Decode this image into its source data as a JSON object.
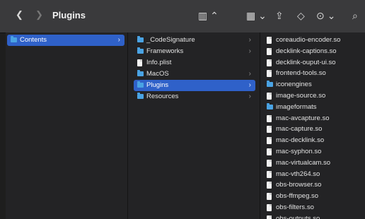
{
  "window": {
    "title": "Plugins"
  },
  "toolbar": {
    "back_glyph": "❮",
    "forward_glyph": "❯",
    "view_glyph": "▥ ⌃",
    "group_glyph": "▦ ⌄",
    "share_glyph": "⇪",
    "tag_glyph": "◇",
    "more_glyph": "⊙ ⌄",
    "search_glyph": "⌕"
  },
  "columns": {
    "col1": [
      {
        "name": "Contents",
        "type": "folder",
        "has_children": true,
        "selected": true
      }
    ],
    "col2": [
      {
        "name": "_CodeSignature",
        "type": "folder",
        "has_children": true,
        "selected": false
      },
      {
        "name": "Frameworks",
        "type": "folder",
        "has_children": true,
        "selected": false
      },
      {
        "name": "Info.plist",
        "type": "file",
        "has_children": false,
        "selected": false
      },
      {
        "name": "MacOS",
        "type": "folder",
        "has_children": true,
        "selected": false
      },
      {
        "name": "Plugins",
        "type": "folder",
        "has_children": true,
        "selected": true
      },
      {
        "name": "Resources",
        "type": "folder",
        "has_children": true,
        "selected": false
      }
    ],
    "col3": [
      {
        "name": "coreaudio-encoder.so",
        "type": "file"
      },
      {
        "name": "decklink-captions.so",
        "type": "file"
      },
      {
        "name": "decklink-ouput-ui.so",
        "type": "file"
      },
      {
        "name": "frontend-tools.so",
        "type": "file"
      },
      {
        "name": "iconengines",
        "type": "folder"
      },
      {
        "name": "image-source.so",
        "type": "file"
      },
      {
        "name": "imageformats",
        "type": "folder"
      },
      {
        "name": "mac-avcapture.so",
        "type": "file"
      },
      {
        "name": "mac-capture.so",
        "type": "file"
      },
      {
        "name": "mac-decklink.so",
        "type": "file"
      },
      {
        "name": "mac-syphon.so",
        "type": "file"
      },
      {
        "name": "mac-virtualcam.so",
        "type": "file"
      },
      {
        "name": "mac-vth264.so",
        "type": "file"
      },
      {
        "name": "obs-browser.so",
        "type": "file"
      },
      {
        "name": "obs-ffmpeg.so",
        "type": "file"
      },
      {
        "name": "obs-filters.so",
        "type": "file"
      },
      {
        "name": "obs-outputs.so",
        "type": "file"
      }
    ]
  },
  "colors": {
    "folder": "#4aa3e4",
    "selection": "#2f61c9",
    "toolbar": "#3a3a3c",
    "background": "#232325"
  }
}
